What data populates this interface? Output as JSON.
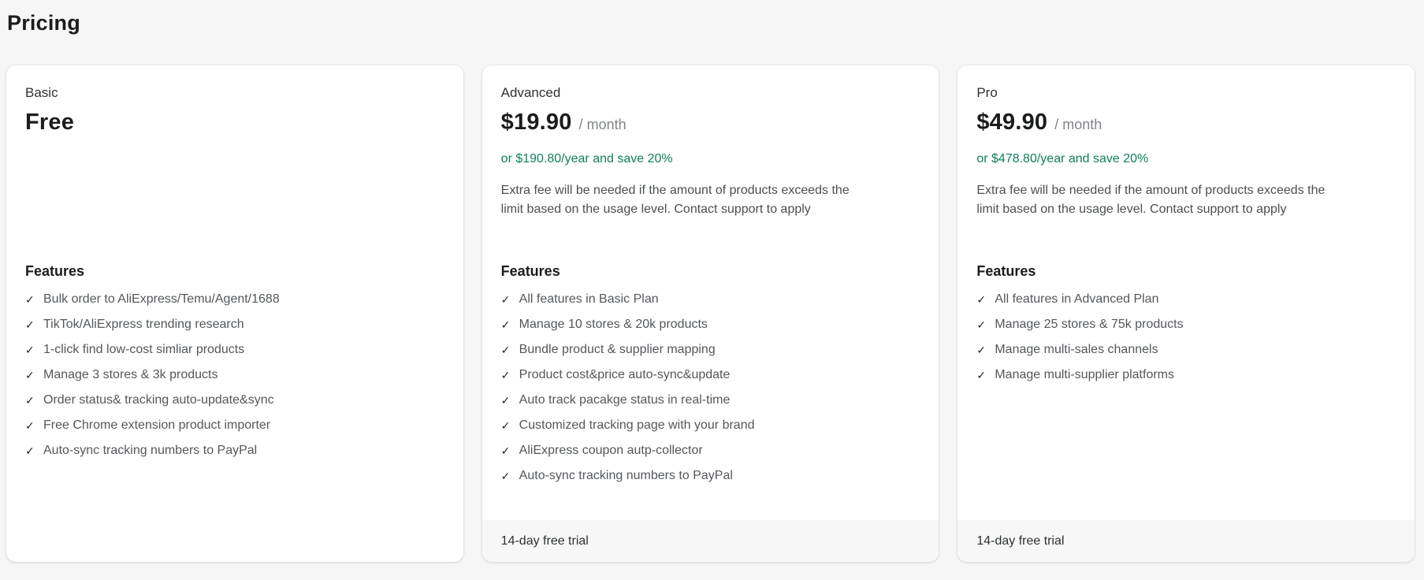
{
  "page": {
    "title": "Pricing"
  },
  "icons": {
    "check": "✓"
  },
  "colors": {
    "page_background": "#f6f6f7",
    "card_background": "#ffffff",
    "savings_green": "#108057",
    "footer_strip": "#f7f7f7"
  },
  "plans": [
    {
      "name": "Basic",
      "price": "Free",
      "features_title": "Features",
      "features": [
        "Bulk order to AliExpress/Temu/Agent/1688",
        "TikTok/AliExpress trending research",
        "1-click find low-cost simliar products",
        "Manage 3 stores & 3k products",
        "Order status& tracking auto-update&sync",
        "Free Chrome extension product importer",
        "Auto-sync tracking numbers to PayPal"
      ]
    },
    {
      "name": "Advanced",
      "price": "$19.90",
      "period": "/ month",
      "yearly": "or $190.80/year and save 20%",
      "note": "Extra fee will be needed if the amount of products exceeds the limit based on the usage level. Contact support to apply",
      "features_title": "Features",
      "features": [
        "All features in Basic Plan",
        "Manage 10 stores & 20k products",
        "Bundle product & supplier mapping",
        "Product cost&price auto-sync&update",
        "Auto track pacakge status in real-time",
        "Customized tracking page with your brand",
        "AliExpress coupon autp-collector",
        "Auto-sync tracking numbers to PayPal"
      ],
      "footer": "14-day free trial"
    },
    {
      "name": "Pro",
      "price": "$49.90",
      "period": "/ month",
      "yearly": "or $478.80/year and save 20%",
      "note": "Extra fee will be needed if the amount of products exceeds the limit based on the usage level. Contact support to apply",
      "features_title": "Features",
      "features": [
        "All features in Advanced Plan",
        "Manage 25 stores & 75k products",
        "Manage multi-sales channels",
        "Manage multi-supplier platforms"
      ],
      "footer": "14-day free trial"
    }
  ]
}
